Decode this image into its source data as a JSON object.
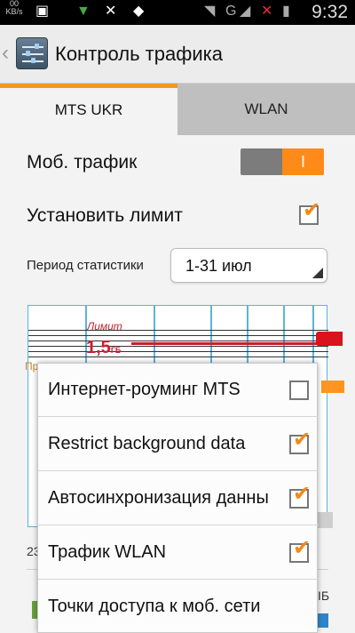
{
  "status": {
    "kbs_value": "00",
    "kbs_unit": "KB/s",
    "network": "G",
    "time": "9:32"
  },
  "header": {
    "back_glyph": "‹",
    "title": "Контроль трафика"
  },
  "tabs": [
    {
      "label": "MTS UKR",
      "selected": true
    },
    {
      "label": "WLAN",
      "selected": false
    }
  ],
  "settings": {
    "mobile_data_label": "Моб. трафик",
    "toggle_value": "I",
    "set_limit_label": "Установить лимит",
    "set_limit_checked": true,
    "period_label": "Период статистики",
    "period_value": "1-31 июл"
  },
  "chart": {
    "limit_label": "Лимит",
    "limit_value": "1,5",
    "limit_unit": "ГБ"
  },
  "partial": {
    "bottom_left": "23",
    "bottom_right": "ІБ"
  },
  "menu": {
    "items": [
      {
        "label": "Интернет-роуминг MTS",
        "checked": false
      },
      {
        "label": "Restrict background data",
        "checked": true
      },
      {
        "label": "Автосинхронизация данных",
        "checked": true
      },
      {
        "label": "Трафик WLAN",
        "checked": true
      },
      {
        "label": "Точки доступа к моб. сети",
        "checked": null
      }
    ]
  },
  "colors": {
    "accent": "#ff8a1a",
    "limit": "#c8202c",
    "grid": "#5ab4dc"
  }
}
